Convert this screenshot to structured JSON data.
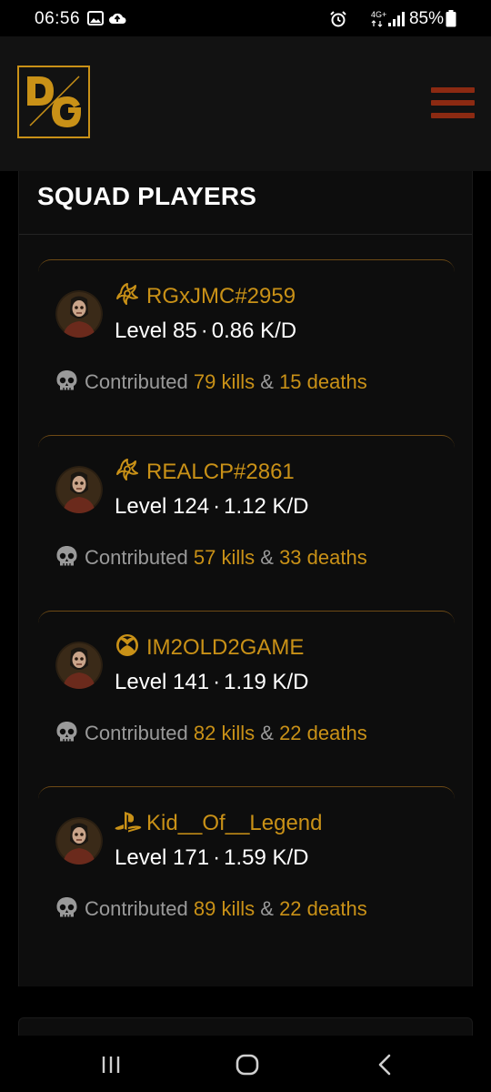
{
  "status_bar": {
    "time": "06:56",
    "network": "4G+",
    "battery": "85%"
  },
  "header": {
    "logo_text": "DG",
    "accent_color": "#c99117",
    "menu_color": "#8c2a12"
  },
  "squad": {
    "title": "SQUAD PLAYERS",
    "players": [
      {
        "platform": "battlenet-icon",
        "gamertag": "RGxJMC#2959",
        "level_label": "Level 85",
        "kd_label": "0.86 K/D",
        "contrib_prefix": "Contributed",
        "kills_label": "79 kills",
        "amp": "&",
        "deaths_label": "15 deaths"
      },
      {
        "platform": "battlenet-icon",
        "gamertag": "REALCP#2861",
        "level_label": "Level 124",
        "kd_label": "1.12 K/D",
        "contrib_prefix": "Contributed",
        "kills_label": "57 kills",
        "amp": "&",
        "deaths_label": "33 deaths"
      },
      {
        "platform": "xbox-icon",
        "gamertag": "IM2OLD2GAME",
        "level_label": "Level 141",
        "kd_label": "1.19 K/D",
        "contrib_prefix": "Contributed",
        "kills_label": "82 kills",
        "amp": "&",
        "deaths_label": "22 deaths"
      },
      {
        "platform": "playstation-icon",
        "gamertag": "Kid__Of__Legend",
        "level_label": "Level 171",
        "kd_label": "1.59 K/D",
        "contrib_prefix": "Contributed",
        "kills_label": "89 kills",
        "amp": "&",
        "deaths_label": "22 deaths"
      }
    ]
  },
  "nav_bar": {
    "recents": "recents-icon",
    "home": "home-icon",
    "back": "back-icon"
  }
}
